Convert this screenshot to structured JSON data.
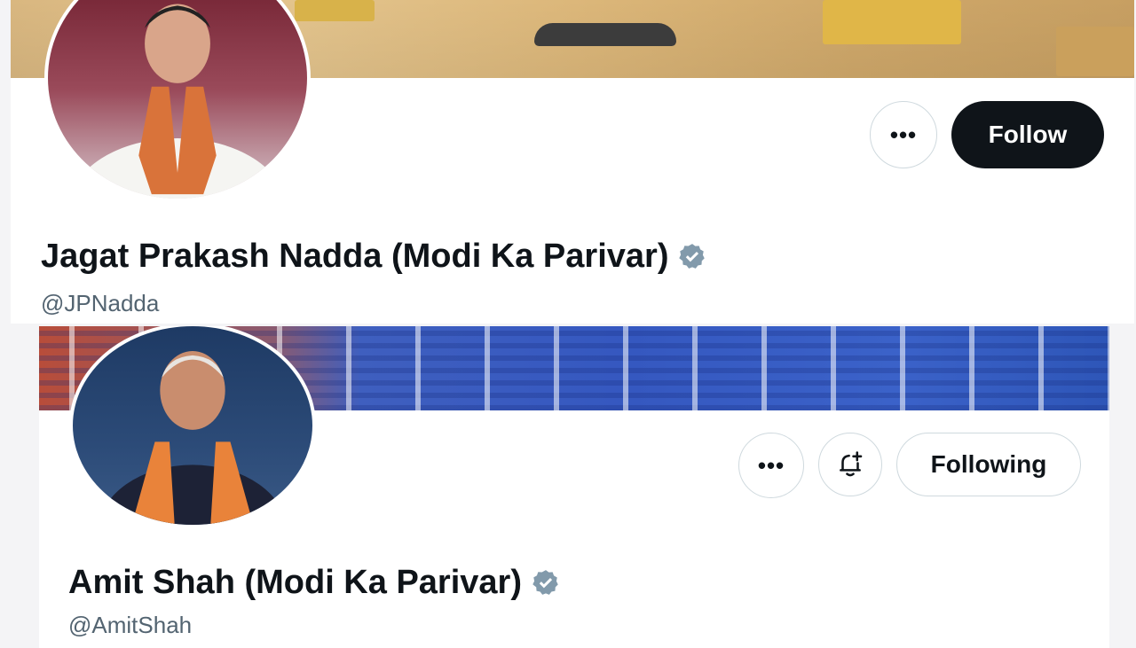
{
  "profiles": [
    {
      "name": "Jagat Prakash Nadda (Modi Ka Parivar)",
      "handle": "@JPNadda",
      "verified": true,
      "more_label": "•••",
      "follow_label": "Follow"
    },
    {
      "name": "Amit Shah (Modi Ka Parivar)",
      "handle": "@AmitShah",
      "verified": true,
      "more_label": "•••",
      "following_label": "Following"
    }
  ],
  "colors": {
    "follow_bg": "#0f1419",
    "verified_badge": "#829aab",
    "handle_text": "#536471"
  }
}
